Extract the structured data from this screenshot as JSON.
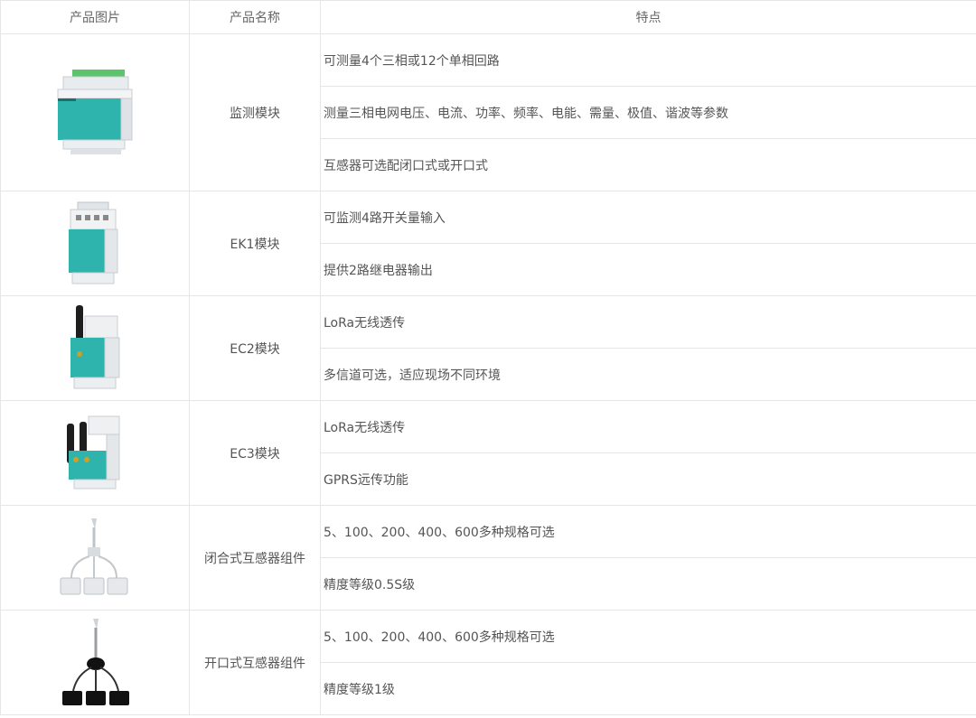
{
  "header": {
    "col_image": "产品图片",
    "col_name": "产品名称",
    "col_features": "特点"
  },
  "products": [
    {
      "name": "监测模块",
      "icon": "monitor-module-icon",
      "features": [
        "可测量4个三相或12个单相回路",
        "测量三相电网电压、电流、功率、频率、电能、需量、极值、谐波等参数",
        "互感器可选配闭口式或开口式"
      ]
    },
    {
      "name": "EK1模块",
      "icon": "ek1-module-icon",
      "features": [
        "可监测4路开关量输入",
        "提供2路继电器输出"
      ]
    },
    {
      "name": "EC2模块",
      "icon": "ec2-module-icon",
      "features": [
        "LoRa无线透传",
        "多信道可选，适应现场不同环境"
      ]
    },
    {
      "name": "EC3模块",
      "icon": "ec3-module-icon",
      "features": [
        "LoRa无线透传",
        "GPRS远传功能"
      ]
    },
    {
      "name": "闭合式互感器组件",
      "icon": "closed-transformer-icon",
      "features": [
        "5、100、200、400、600多种规格可选",
        "精度等级0.5S级"
      ]
    },
    {
      "name": "开口式互感器组件",
      "icon": "split-core-transformer-icon",
      "features": [
        "5、100、200、400、600多种规格可选",
        "精度等级1级"
      ]
    }
  ],
  "colors": {
    "border": "#e6e6e6",
    "teal": "#2fb3ad",
    "text": "#555555"
  }
}
